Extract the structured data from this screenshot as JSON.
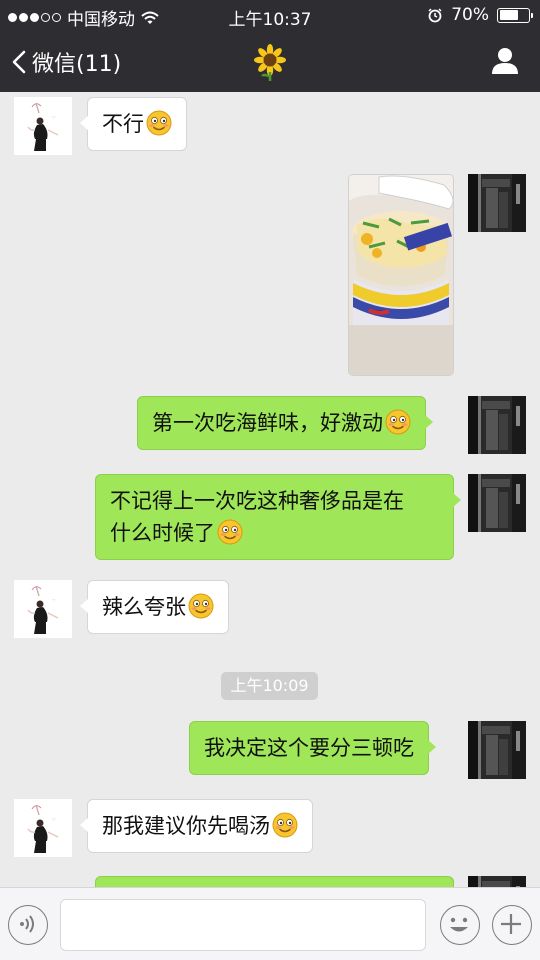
{
  "status_bar": {
    "carrier": "中国移动",
    "time": "上午10:37",
    "battery": "70%",
    "battery_level": 0.7,
    "signal_bars": 3,
    "signal_total": 5
  },
  "nav": {
    "back_label": "微信(11)",
    "title_icon": "sunflower-icon",
    "profile_icon": "person-icon"
  },
  "messages": [
    {
      "side": "left",
      "text": "不行",
      "emoji": "smile-emoji"
    },
    {
      "side": "right",
      "type": "image",
      "content": "photo"
    },
    {
      "side": "right",
      "text": "第一次吃海鲜味，好激动",
      "emoji": "smile-emoji"
    },
    {
      "side": "right",
      "text_line1": "不记得上一次吃这种奢侈品是在",
      "text_line2": "什么时候了",
      "emoji": "smile-emoji"
    },
    {
      "side": "left",
      "text": "辣么夸张",
      "emoji": "smile-emoji"
    },
    {
      "type": "timestamp",
      "text": "上午10:09"
    },
    {
      "side": "right",
      "text": "我决定这个要分三顿吃"
    },
    {
      "side": "left",
      "text": "那我建议你先喝汤",
      "emoji": "smile-emoji"
    }
  ],
  "input_bar": {
    "voice_icon": "voice-icon",
    "emoji_icon": "emoji-icon",
    "add_icon": "plus-icon",
    "placeholder": ""
  },
  "colors": {
    "header_bg": "#2e2e32",
    "chat_bg": "#ebebeb",
    "sent_bubble": "#9fe658",
    "received_bubble": "#ffffff"
  }
}
